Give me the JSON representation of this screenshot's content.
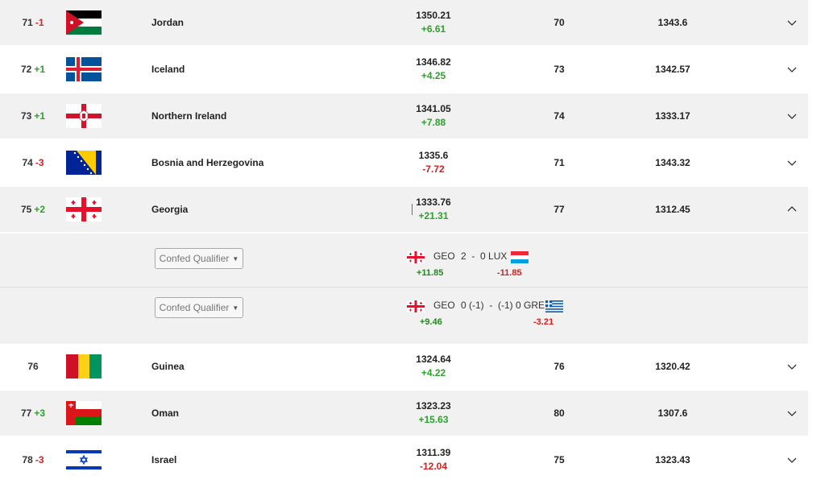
{
  "rows_before": [
    {
      "rank": "71",
      "move": "-1",
      "dir": "down",
      "flag": "jordan",
      "country": "Jordan",
      "points": "1350.21",
      "delta": "+6.61",
      "delta_dir": "up",
      "prev_rank": "70",
      "prev_points": "1343.6",
      "shade": "white"
    },
    {
      "rank": "72",
      "move": "+1",
      "dir": "up",
      "flag": "iceland",
      "country": "Iceland",
      "points": "1346.82",
      "delta": "+4.25",
      "delta_dir": "up",
      "prev_rank": "73",
      "prev_points": "1342.57",
      "shade": "alt"
    },
    {
      "rank": "73",
      "move": "+1",
      "dir": "up",
      "flag": "northern-ireland",
      "country": "Northern Ireland",
      "points": "1341.05",
      "delta": "+7.88",
      "delta_dir": "up",
      "prev_rank": "74",
      "prev_points": "1333.17",
      "shade": "white"
    },
    {
      "rank": "74",
      "move": "-3",
      "dir": "down",
      "flag": "bosnia",
      "country": "Bosnia and Herzegovina",
      "points": "1335.6",
      "delta": "-7.72",
      "delta_dir": "down",
      "prev_rank": "71",
      "prev_points": "1343.32",
      "shade": "alt"
    },
    {
      "rank": "75",
      "move": "+2",
      "dir": "up",
      "flag": "georgia",
      "country": "Georgia",
      "points": "1333.76",
      "delta": "+21.31",
      "delta_dir": "up",
      "prev_rank": "77",
      "prev_points": "1312.45",
      "shade": "white",
      "expanded": true
    }
  ],
  "matches": [
    {
      "dropdown": "Confed Qualifier",
      "home": "GEO",
      "score": "2  -  0",
      "away": "LUX",
      "home_delta": "+11.85",
      "away_delta": "-11.85",
      "away_flag": "luxembourg"
    },
    {
      "dropdown": "Confed Qualifier",
      "home": "GEO",
      "score": "0 (-1)  -  (-1) 0",
      "away": "GRE",
      "home_delta": "+9.46",
      "away_delta": "-3.21",
      "away_flag": "greece"
    }
  ],
  "rows_after": [
    {
      "rank": "76",
      "move": "",
      "dir": "none",
      "flag": "guinea",
      "country": "Guinea",
      "points": "1324.64",
      "delta": "+4.22",
      "delta_dir": "up",
      "prev_rank": "76",
      "prev_points": "1320.42",
      "shade": "white"
    },
    {
      "rank": "77",
      "move": "+3",
      "dir": "up",
      "flag": "oman",
      "country": "Oman",
      "points": "1323.23",
      "delta": "+15.63",
      "delta_dir": "up",
      "prev_rank": "80",
      "prev_points": "1307.6",
      "shade": "alt"
    },
    {
      "rank": "78",
      "move": "-3",
      "dir": "down",
      "flag": "israel",
      "country": "Israel",
      "points": "1311.39",
      "delta": "-12.04",
      "delta_dir": "down",
      "prev_rank": "75",
      "prev_points": "1323.43",
      "shade": "white"
    }
  ],
  "colors": {
    "up": "#2ea02e",
    "down": "#d32020",
    "row_alt": "#f1f1f1"
  }
}
